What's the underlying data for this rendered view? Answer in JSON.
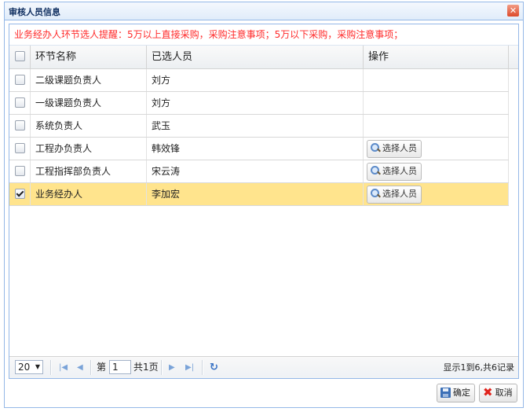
{
  "dialog": {
    "title": "审核人员信息",
    "close_icon": "close-icon",
    "notice": "业务经办人环节选人提醒：5万以上直接采购，采购注意事项；5万以下采购，采购注意事项；"
  },
  "grid": {
    "columns": [
      "环节名称",
      "已选人员",
      "操作"
    ],
    "rows": [
      {
        "stage": "二级课题负责人",
        "person": "刘方",
        "checked": false,
        "action": ""
      },
      {
        "stage": "一级课题负责人",
        "person": "刘方",
        "checked": false,
        "action": ""
      },
      {
        "stage": "系统负责人",
        "person": "武玉",
        "checked": false,
        "action": ""
      },
      {
        "stage": "工程办负责人",
        "person": "韩效锋",
        "checked": false,
        "action": "选择人员"
      },
      {
        "stage": "工程指挥部负责人",
        "person": "宋云涛",
        "checked": false,
        "action": "选择人员"
      },
      {
        "stage": "业务经办人",
        "person": "李加宏",
        "checked": true,
        "action": "选择人员"
      }
    ]
  },
  "pager": {
    "page_size": "20",
    "page_label_before": "第",
    "page_number": "1",
    "page_label_after": "共1页",
    "info": "显示1到6,共6记录"
  },
  "footer": {
    "ok_label": "确定",
    "cancel_label": "取消"
  },
  "colors": {
    "border": "#95b8e7",
    "notice": "#ff2a2a",
    "selected_row": "#ffe48d"
  }
}
